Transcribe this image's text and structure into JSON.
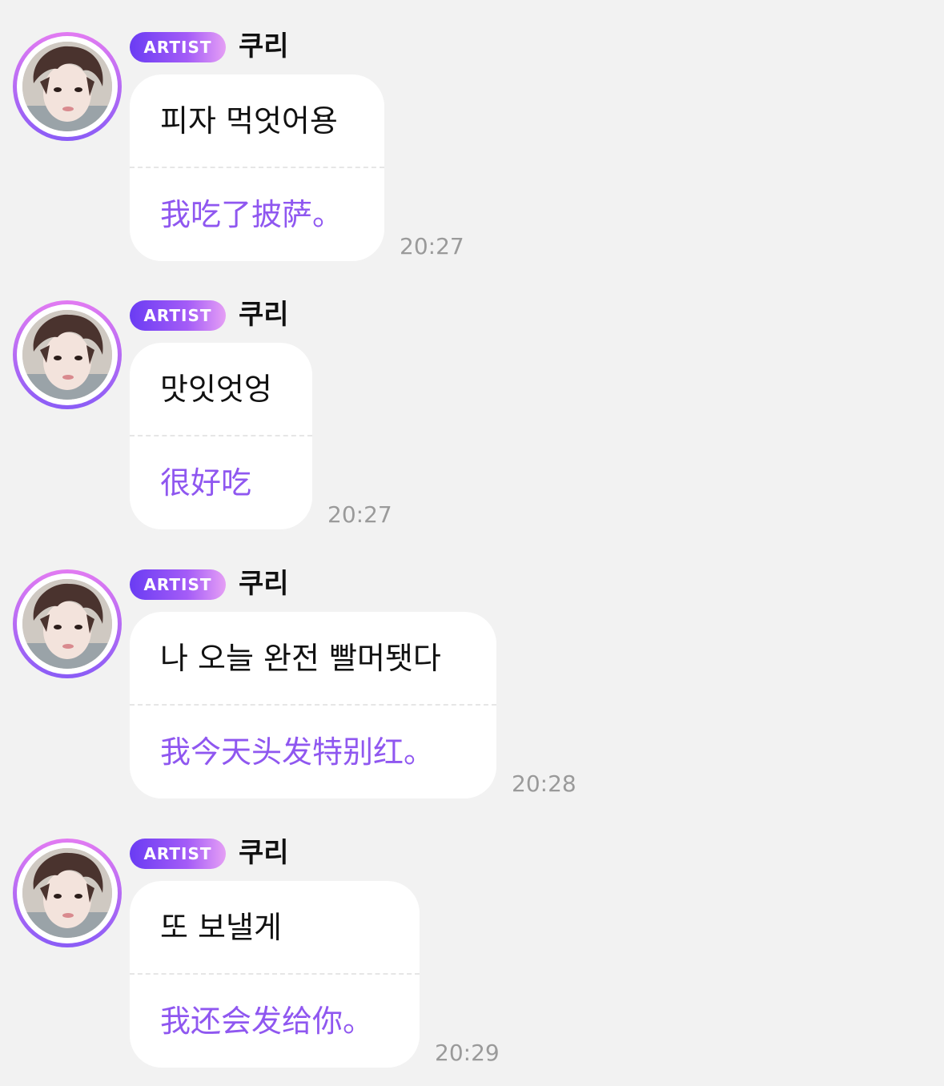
{
  "colors": {
    "background": "#f2f2f2",
    "bubble": "#ffffff",
    "translation_text": "#8f57f0",
    "badge_gradient_start": "#6a3cf3",
    "badge_gradient_end": "#e59ff5",
    "timestamp": "#9a9a9a"
  },
  "messages": [
    {
      "badge": "ARTIST",
      "name": "쿠리",
      "avatar_icon": "artist-avatar",
      "text": "피자 먹엇어용",
      "translation": "我吃了披萨。",
      "time": "20:27"
    },
    {
      "badge": "ARTIST",
      "name": "쿠리",
      "avatar_icon": "artist-avatar",
      "text": "맛잇엇엉",
      "translation": "很好吃",
      "time": "20:27"
    },
    {
      "badge": "ARTIST",
      "name": "쿠리",
      "avatar_icon": "artist-avatar",
      "text": "나 오늘 완전 빨머됏다",
      "translation": "我今天头发特别红。",
      "time": "20:28"
    },
    {
      "badge": "ARTIST",
      "name": "쿠리",
      "avatar_icon": "artist-avatar",
      "text": "또 보낼게",
      "translation": "我还会发给你。",
      "time": "20:29"
    }
  ]
}
